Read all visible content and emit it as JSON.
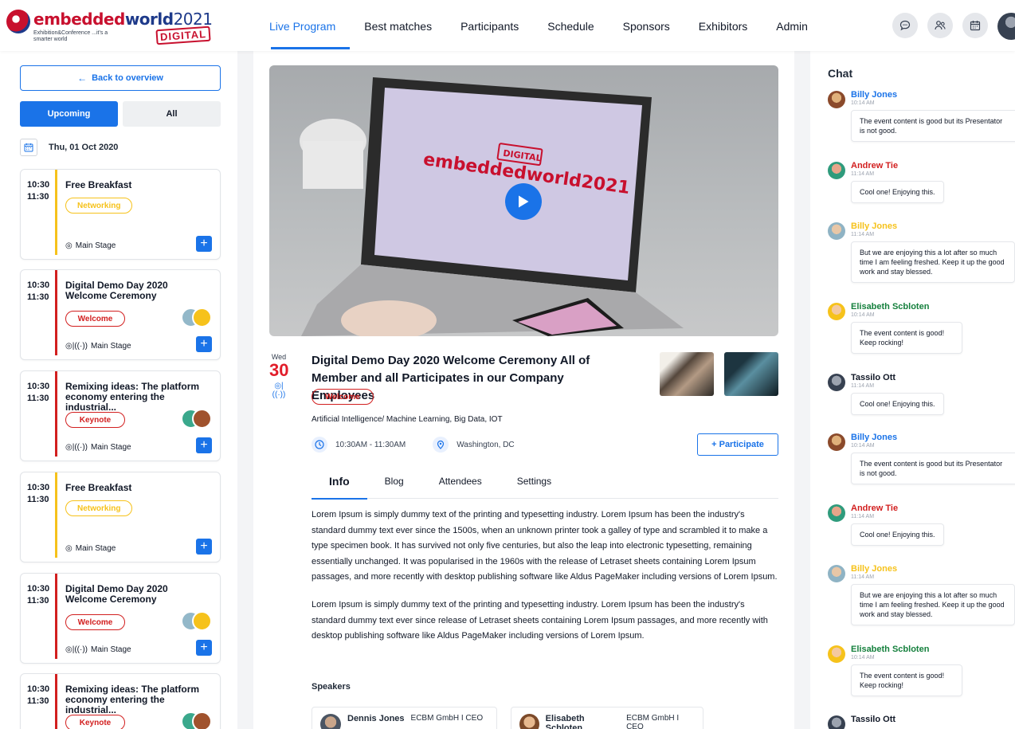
{
  "brand": {
    "word_red": "embedded",
    "word_blue": "world",
    "year": "2021",
    "sub": "Exhibition&Conference ...it's a smarter world",
    "badge": "DIGITAL"
  },
  "nav": [
    "Live Program",
    "Best matches",
    "Participants",
    "Schedule",
    "Sponsors",
    "Exhibitors",
    "Admin"
  ],
  "sidebar": {
    "back_label": "Back to overview",
    "filter_upcoming": "Upcoming",
    "filter_all": "All",
    "date": "Thu, 01 Oct 2020",
    "sessions": [
      {
        "start": "10:30",
        "end": "11:30",
        "title": "Free Breakfast",
        "tag": "Networking",
        "location": "Main Stage"
      },
      {
        "start": "10:30",
        "end": "11:30",
        "title": "Digital Demo Day 2020 Welcome Ceremony",
        "tag": "Welcome",
        "location": "Main Stage"
      },
      {
        "start": "10:30",
        "end": "11:30",
        "title": "Remixing ideas: The platform economy entering the industrial...",
        "tag": "Keynote",
        "location": "Main Stage"
      },
      {
        "start": "10:30",
        "end": "11:30",
        "title": "Free Breakfast",
        "tag": "Networking",
        "location": "Main Stage"
      },
      {
        "start": "10:30",
        "end": "11:30",
        "title": "Digital Demo Day 2020 Welcome Ceremony",
        "tag": "Welcome",
        "location": "Main Stage"
      },
      {
        "start": "10:30",
        "end": "11:30",
        "title": "Remixing ideas: The platform economy entering the industrial...",
        "tag": "Keynote",
        "location": ""
      }
    ]
  },
  "event": {
    "weekday": "Wed",
    "day": "30",
    "title": "Digital Demo Day 2020 Welcome Ceremony All of Member and all Participates in our Company Employees",
    "tag": "Welcome",
    "categories": "Artificial Intelligence/ Machine Learning, Big Data, IOT",
    "time": "10:30AM - 11:30AM",
    "location": "Washington, DC",
    "participate_label": "+ Participate",
    "tabs": [
      "Info",
      "Blog",
      "Attendees",
      "Settings"
    ],
    "para1": "Lorem Ipsum is simply dummy text of the printing and typesetting industry. Lorem Ipsum has been the industry's standard dummy text ever since the 1500s, when an unknown printer took a galley of type and scrambled it to make a type specimen book. It has survived not only five centuries, but also the leap into electronic typesetting, remaining essentially unchanged. It was popularised in the 1960s with the release of Letraset sheets containing Lorem Ipsum passages, and more recently with desktop publishing software like Aldus PageMaker including versions of Lorem Ipsum.",
    "para2": "Lorem Ipsum is simply dummy text of the printing and typesetting industry. Lorem Ipsum has been the industry's standard dummy text ever since release of Letraset sheets containing Lorem Ipsum passages, and more recently with desktop publishing software like Aldus PageMaker including versions of Lorem Ipsum.",
    "speakers_heading": "Speakers",
    "speakers": [
      {
        "name": "Dennis Jones",
        "role": "ECBM GmbH I CEO"
      },
      {
        "name": "Elisabeth Scbloten",
        "role": "ECBM GmbH I CEO"
      }
    ],
    "video_text": {
      "brand": "embeddedworld2021",
      "badge": "DIGITAL"
    }
  },
  "chat": {
    "title": "Chat",
    "messages": [
      {
        "name": "Billy Jones",
        "time": "10:14 AM",
        "text": "The event content is good but its Presentator is not good.",
        "color": "#1a73e8"
      },
      {
        "name": "Andrew Tie",
        "time": "11:14 AM",
        "text": "Cool one! Enjoying this.",
        "color": "#d21f1f"
      },
      {
        "name": "Billy Jones",
        "time": "11:14 AM",
        "text": "But we are enjoying this a lot after so much time I am feeling freshed. Keep it up the good work and stay blessed.",
        "color": "#f6c21b"
      },
      {
        "name": "Elisabeth Scbloten",
        "time": "10:14 AM",
        "text": "The event content is good! Keep rocking!",
        "color": "#15803d"
      },
      {
        "name": "Tassilo Ott",
        "time": "11:14 AM",
        "text": "Cool one! Enjoying this.",
        "color": "#111827"
      },
      {
        "name": "Billy Jones",
        "time": "10:14 AM",
        "text": "The event content is good but its Presentator is not good.",
        "color": "#1a73e8"
      },
      {
        "name": "Andrew Tie",
        "time": "11:14 AM",
        "text": "Cool one! Enjoying this.",
        "color": "#d21f1f"
      },
      {
        "name": "Billy Jones",
        "time": "11:14 AM",
        "text": "But we are enjoying this a lot after so much time I am feeling freshed. Keep it up the good work and stay blessed.",
        "color": "#f6c21b"
      },
      {
        "name": "Elisabeth Scbloten",
        "time": "10:14 AM",
        "text": "The event content is good! Keep rocking!",
        "color": "#15803d"
      },
      {
        "name": "Tassilo Ott",
        "time": "",
        "text": "",
        "color": "#111827"
      }
    ]
  },
  "colors": {
    "accent": "#1a73e8",
    "welcome": "#d21f1f",
    "networking": "#f6c21b"
  }
}
